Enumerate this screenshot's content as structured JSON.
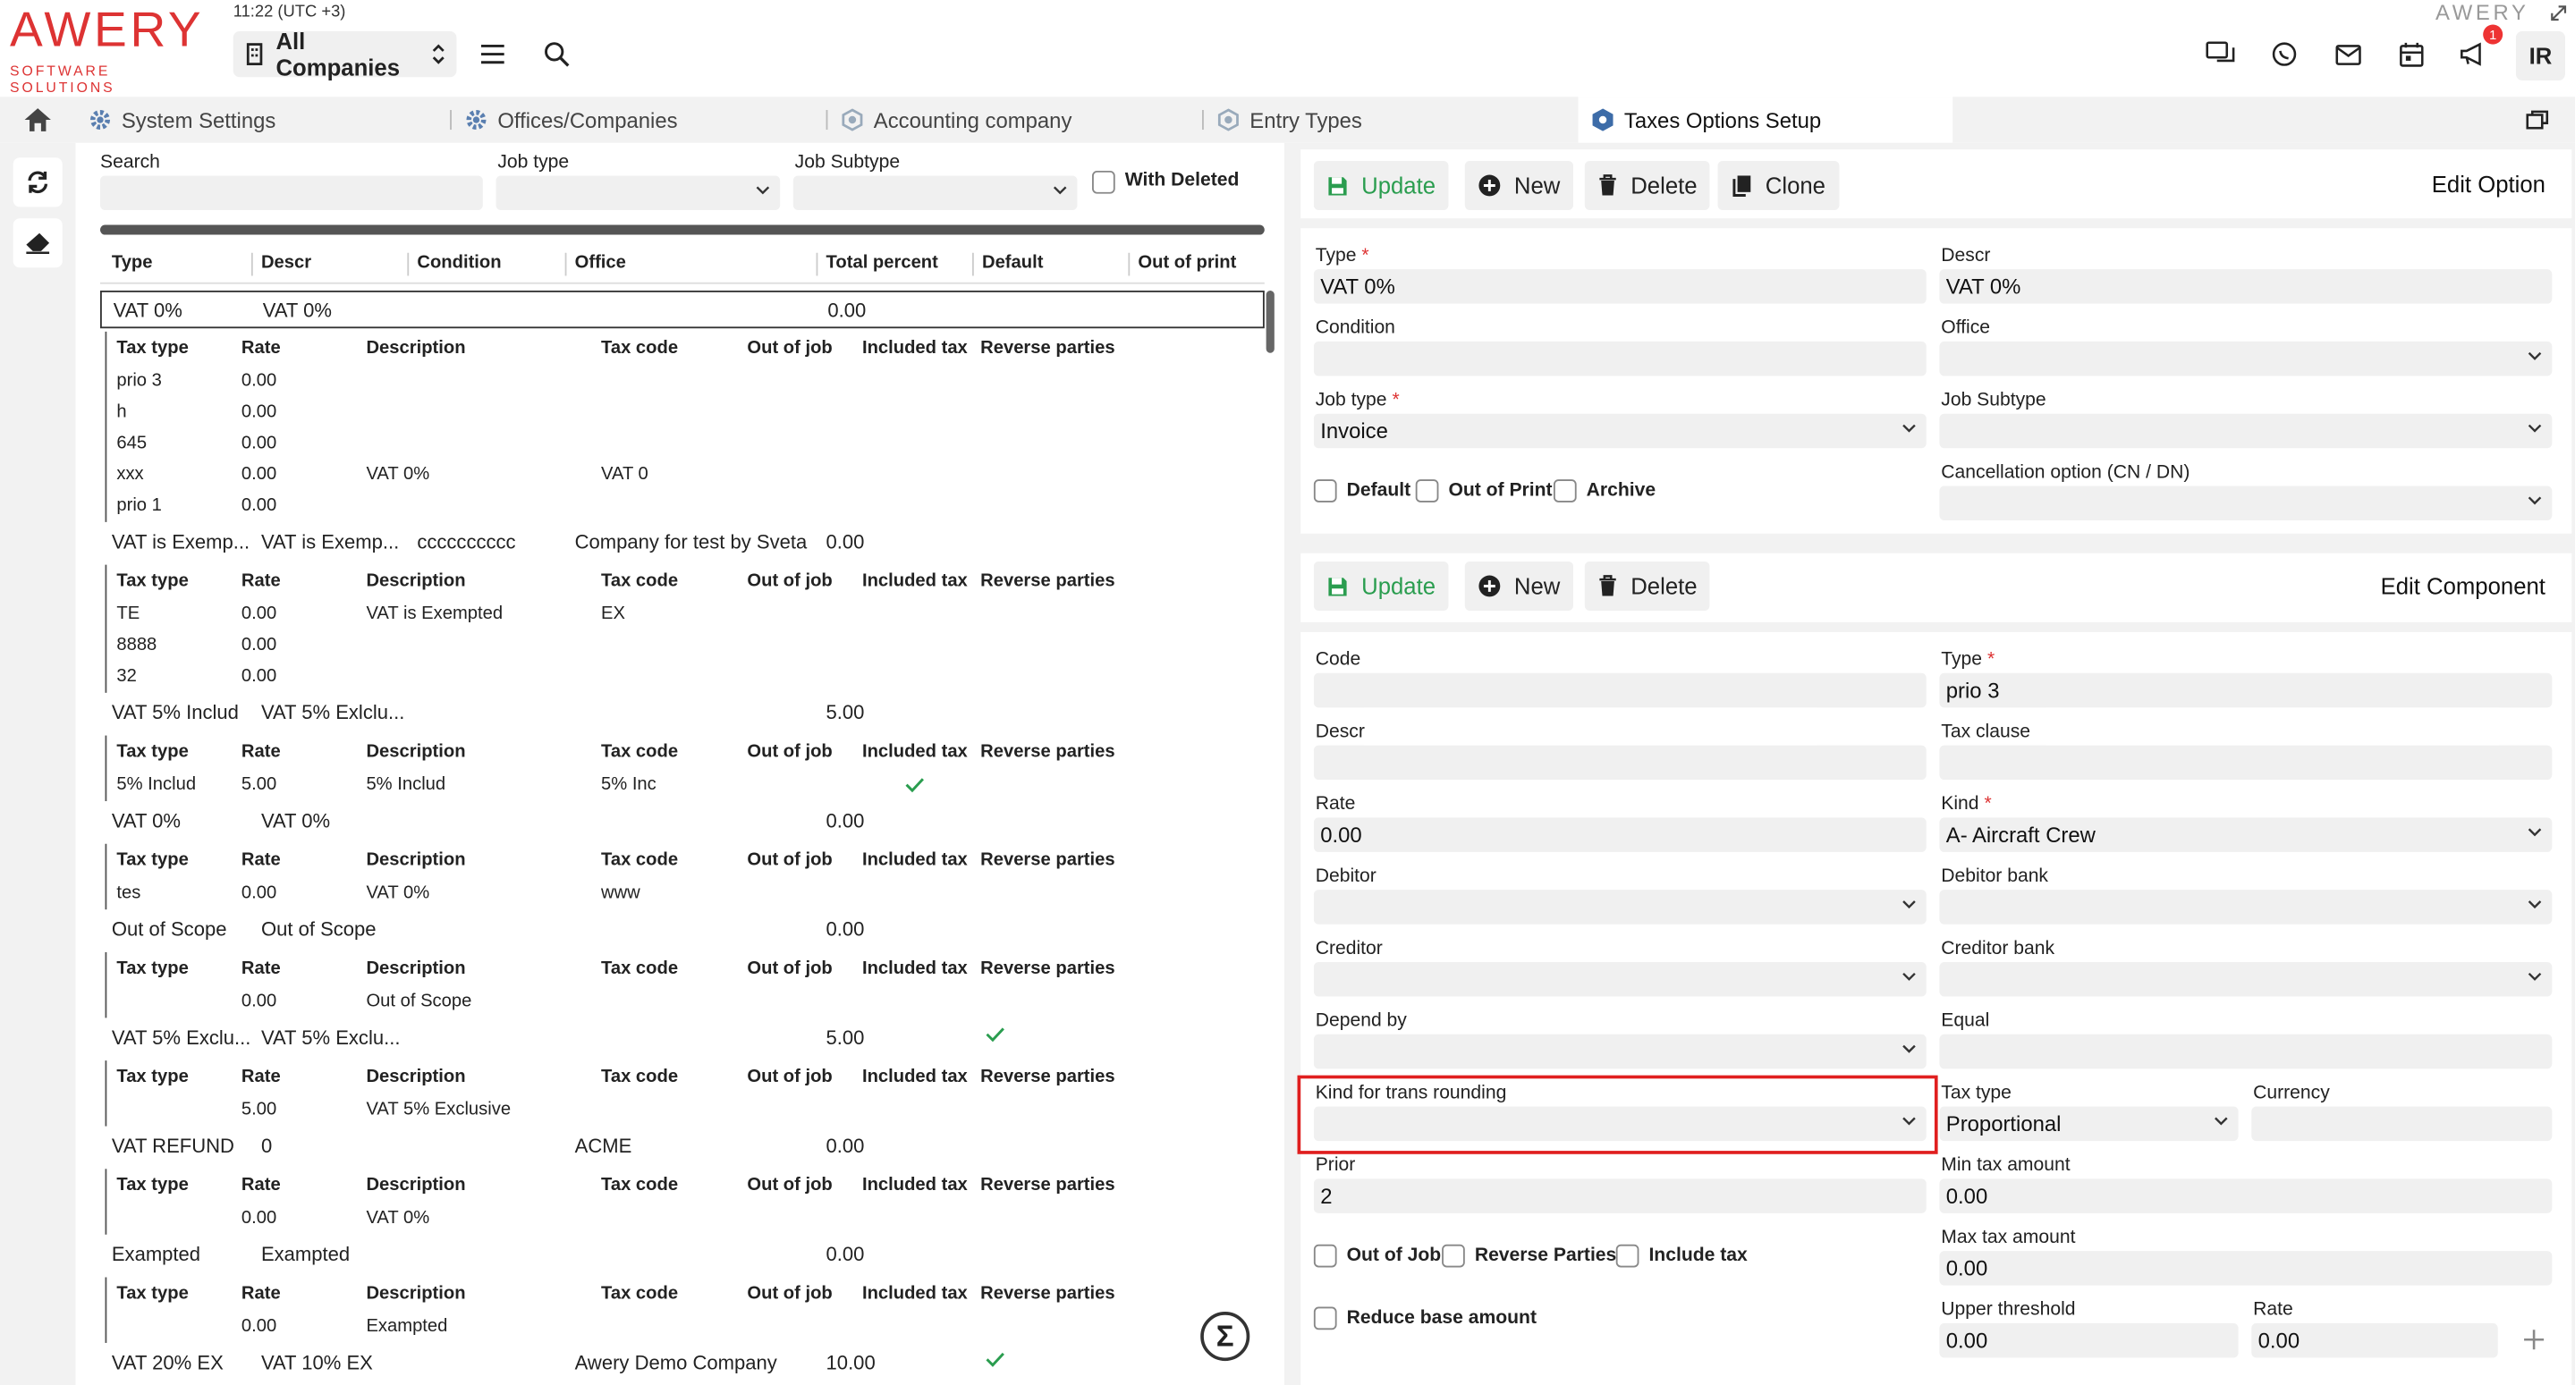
{
  "brand": {
    "name": "AWERY",
    "tagline": "SOFTWARE SOLUTIONS",
    "corner_logo": "AWERY"
  },
  "header": {
    "time": "11:22 (UTC +3)",
    "company": "All Companies",
    "notifications": "1",
    "user_initials": "IR"
  },
  "tabs": [
    {
      "label": "System Settings"
    },
    {
      "label": "Offices/Companies"
    },
    {
      "label": "Accounting company"
    },
    {
      "label": "Entry Types"
    },
    {
      "label": "Taxes Options Setup"
    }
  ],
  "filters": {
    "search_label": "Search",
    "job_type_label": "Job type",
    "job_subtype_label": "Job Subtype",
    "with_deleted_label": "With Deleted"
  },
  "columns": [
    "Type",
    "Descr",
    "Condition",
    "Office",
    "Total percent",
    "Default",
    "Out of print"
  ],
  "sub_columns": [
    "Tax type",
    "Rate",
    "Description",
    "Tax code",
    "Out of job",
    "Included tax",
    "Reverse parties"
  ],
  "groups": [
    {
      "type": "VAT 0%",
      "descr": "VAT 0%",
      "condition": "",
      "office": "",
      "total": "0.00",
      "default": false,
      "items": [
        {
          "tax_type": "prio 3",
          "rate": "0.00",
          "description": "",
          "tax_code": "",
          "included": false
        },
        {
          "tax_type": "h",
          "rate": "0.00",
          "description": "",
          "tax_code": "",
          "included": false
        },
        {
          "tax_type": "645",
          "rate": "0.00",
          "description": "",
          "tax_code": "",
          "included": false
        },
        {
          "tax_type": "xxx",
          "rate": "0.00",
          "description": "VAT 0%",
          "tax_code": "VAT 0",
          "included": false
        },
        {
          "tax_type": "prio 1",
          "rate": "0.00",
          "description": "",
          "tax_code": "",
          "included": false
        }
      ]
    },
    {
      "type": "VAT is Exemp...",
      "descr": "VAT is Exemp...",
      "condition": "cccccccccc",
      "office": "Company for test by Sveta",
      "total": "0.00",
      "default": false,
      "items": [
        {
          "tax_type": "TE",
          "rate": "0.00",
          "description": "VAT is Exempted",
          "tax_code": "EX",
          "included": false
        },
        {
          "tax_type": "8888",
          "rate": "0.00",
          "description": "",
          "tax_code": "",
          "included": false
        },
        {
          "tax_type": "32",
          "rate": "0.00",
          "description": "",
          "tax_code": "",
          "included": false
        }
      ]
    },
    {
      "type": "VAT 5% Includ",
      "descr": "VAT 5% Exlclu...",
      "condition": "",
      "office": "",
      "total": "5.00",
      "default": false,
      "items": [
        {
          "tax_type": "5% Includ",
          "rate": "5.00",
          "description": "5% Includ",
          "tax_code": "5% Inc",
          "included": true
        }
      ]
    },
    {
      "type": "VAT 0%",
      "descr": "VAT 0%",
      "condition": "",
      "office": "",
      "total": "0.00",
      "default": false,
      "items": [
        {
          "tax_type": "tes",
          "rate": "0.00",
          "description": "VAT 0%",
          "tax_code": "www",
          "included": false
        }
      ]
    },
    {
      "type": "Out of Scope",
      "descr": "Out of Scope",
      "condition": "",
      "office": "",
      "total": "0.00",
      "default": false,
      "items": [
        {
          "tax_type": "",
          "rate": "0.00",
          "description": "Out of Scope",
          "tax_code": "",
          "included": false
        }
      ]
    },
    {
      "type": "VAT 5% Exclu...",
      "descr": "VAT 5% Exclu...",
      "condition": "",
      "office": "",
      "total": "5.00",
      "default": true,
      "items": [
        {
          "tax_type": "",
          "rate": "5.00",
          "description": "VAT 5% Exclusive",
          "tax_code": "",
          "included": false
        }
      ]
    },
    {
      "type": "VAT REFUND",
      "descr": "0",
      "condition": "",
      "office": "ACME",
      "total": "0.00",
      "default": false,
      "items": [
        {
          "tax_type": "",
          "rate": "0.00",
          "description": "VAT 0%",
          "tax_code": "",
          "included": false
        }
      ]
    },
    {
      "type": "Exampted",
      "descr": "Exampted",
      "condition": "",
      "office": "",
      "total": "0.00",
      "default": false,
      "items": [
        {
          "tax_type": "",
          "rate": "0.00",
          "description": "Exampted",
          "tax_code": "",
          "included": false
        }
      ]
    },
    {
      "type": "VAT 20% EX",
      "descr": "VAT 10% EX",
      "condition": "",
      "office": "Awery Demo Company",
      "total": "10.00",
      "default": true,
      "items": []
    }
  ],
  "option_panel": {
    "title": "Edit Option",
    "buttons": {
      "update": "Update",
      "new": "New",
      "delete": "Delete",
      "clone": "Clone"
    },
    "fields": {
      "type_label": "Type",
      "type_value": "VAT 0%",
      "descr_label": "Descr",
      "descr_value": "VAT 0%",
      "condition_label": "Condition",
      "office_label": "Office",
      "job_type_label": "Job type",
      "job_type_value": "Invoice",
      "job_subtype_label": "Job Subtype",
      "default_label": "Default",
      "out_of_print_label": "Out of Print",
      "archive_label": "Archive",
      "cancellation_label": "Cancellation option (CN / DN)"
    }
  },
  "component_panel": {
    "title": "Edit Component",
    "buttons": {
      "update": "Update",
      "new": "New",
      "delete": "Delete"
    },
    "fields": {
      "code_label": "Code",
      "type_label": "Type",
      "type_value": "prio 3",
      "descr_label": "Descr",
      "tax_clause_label": "Tax clause",
      "rate_label": "Rate",
      "rate_value": "0.00",
      "kind_label": "Kind",
      "kind_value": "A- Aircraft Crew",
      "debitor_label": "Debitor",
      "debitor_bank_label": "Debitor bank",
      "creditor_label": "Creditor",
      "creditor_bank_label": "Creditor bank",
      "depend_by_label": "Depend by",
      "equal_label": "Equal",
      "kind_rounding_label": "Kind for trans rounding",
      "tax_type_label": "Tax type",
      "tax_type_value": "Proportional",
      "currency_label": "Currency",
      "prior_label": "Prior",
      "prior_value": "2",
      "min_tax_label": "Min tax amount",
      "min_tax_value": "0.00",
      "out_of_job_label": "Out of Job",
      "reverse_parties_label": "Reverse Parties",
      "include_tax_label": "Include tax",
      "max_tax_label": "Max tax amount",
      "max_tax_value": "0.00",
      "reduce_base_label": "Reduce base amount",
      "upper_threshold_label": "Upper threshold",
      "upper_threshold_value": "0.00",
      "rate2_label": "Rate",
      "rate2_value": "0.00"
    }
  },
  "colors": {
    "brand": "#dd3333",
    "accent_green": "#2a9d4f",
    "highlight": "#e01f1f"
  }
}
